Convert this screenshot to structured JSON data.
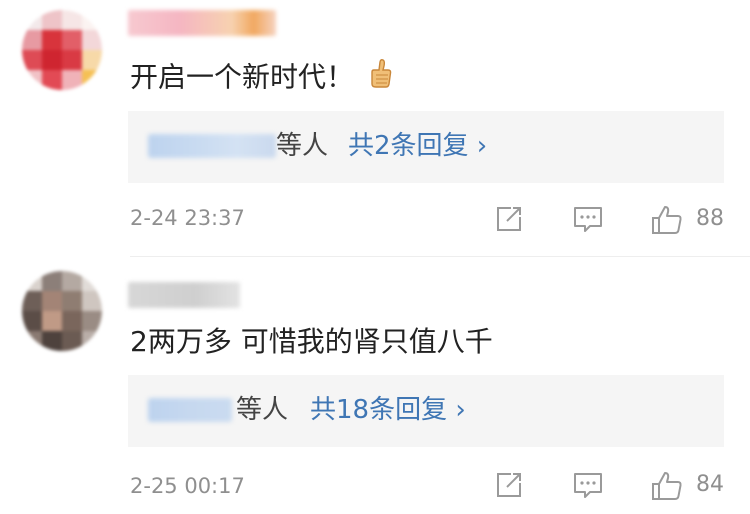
{
  "comments": [
    {
      "text": "开启一个新时代！",
      "reply_suffix": "等人",
      "reply_count": "共2条回复 ›",
      "time": "2-24 23:37",
      "likes": "88",
      "icons": {
        "emoji": "thumbs-up-emoji",
        "share": "share-icon",
        "comment": "comment-icon",
        "like": "like-icon"
      }
    },
    {
      "text": "2两万多 可惜我的肾只值八千",
      "reply_suffix": "等人",
      "reply_count": "共18条回复 ›",
      "time": "2-25 00:17",
      "likes": "84",
      "icons": {
        "share": "share-icon",
        "comment": "comment-icon",
        "like": "like-icon"
      }
    }
  ],
  "colors": {
    "link": "#3f76b4",
    "meta": "#8f8f8f",
    "reply_bg": "#f5f5f5",
    "text": "#222222"
  }
}
